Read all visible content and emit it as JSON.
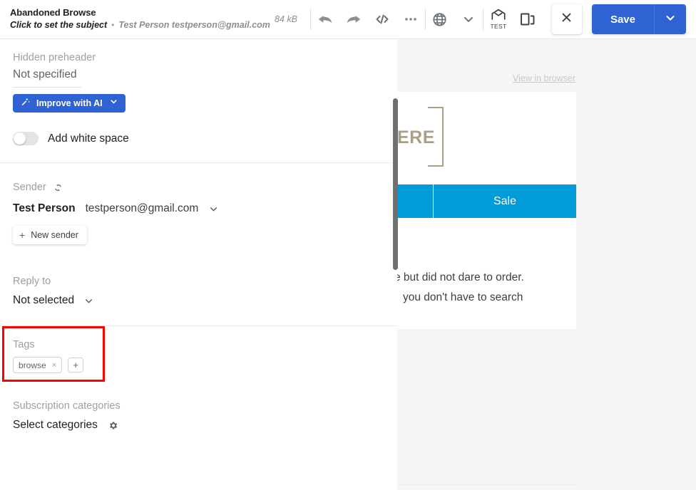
{
  "topbar": {
    "campaign_name": "Abandoned Browse",
    "subject_prompt": "Click to set the subject",
    "separator": "•",
    "sender_summary": "Test Person testperson@gmail.com",
    "size_label": "84 kB",
    "icons": {
      "undo": "undo-icon",
      "redo": "redo-icon",
      "code": "code-icon",
      "more": "more-icon",
      "language": "globe-icon",
      "language_caret": "chevron-down-icon",
      "test": "envelope-test-icon",
      "duplicate": "duplicate-icon",
      "close": "close-icon"
    },
    "test_label": "TEST",
    "save_label": "Save",
    "save_caret": "chevron-down-icon"
  },
  "settings": {
    "preheader": {
      "label": "Hidden preheader",
      "value": "Not specified"
    },
    "ai_button": {
      "label": "Improve with AI",
      "icon": "magic-wand-icon",
      "caret": "chevron-down-icon",
      "color": "#2f63d4"
    },
    "white_space_toggle": {
      "label": "Add white space",
      "state": "off"
    },
    "sender": {
      "label": "Sender",
      "refresh_icon": "refresh-icon",
      "name": "Test Person",
      "email": "testperson@gmail.com",
      "caret": "chevron-down-icon",
      "new_sender_label": "New sender",
      "new_sender_plus": "+"
    },
    "reply_to": {
      "label": "Reply to",
      "value": "Not selected",
      "caret": "chevron-down-icon"
    },
    "tags": {
      "label": "Tags",
      "chips": [
        {
          "text": "browse",
          "remove": "×"
        }
      ],
      "add_label": "+",
      "highlight_color": "#ff0000"
    },
    "subscription_categories": {
      "label": "Subscription categories",
      "value": "Select categories",
      "gear_icon": "gear-icon"
    }
  },
  "preview": {
    "view_in_browser": "View in browser",
    "logo_text": "ERE",
    "nav_items": [
      {
        "label": ""
      },
      {
        "label": "Sale"
      }
    ],
    "nav_color": "#029bd9",
    "body_lines": [
      "e but did not dare to order.",
      "you don't have to search"
    ],
    "scrollbar": "vertical-scrollbar"
  }
}
